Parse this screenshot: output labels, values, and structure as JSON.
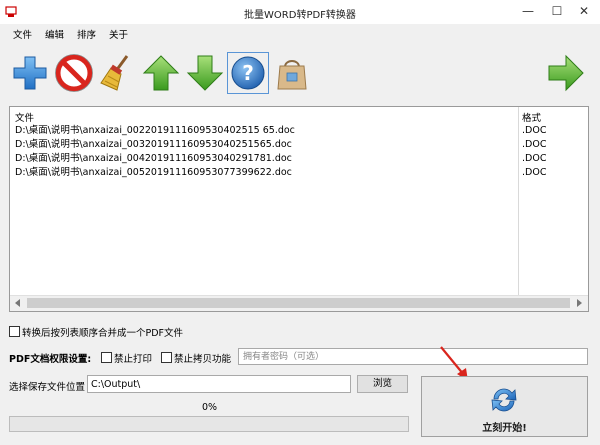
{
  "window": {
    "title": "批量WORD转PDF转换器",
    "minimize": "—",
    "maximize": "☐",
    "close": "✕"
  },
  "menu": [
    "文件",
    "编辑",
    "排序",
    "关于"
  ],
  "toolbar": {
    "buttons": [
      {
        "icon": "add-icon"
      },
      {
        "icon": "remove-icon"
      },
      {
        "icon": "broom-icon"
      },
      {
        "icon": "move-up-icon"
      },
      {
        "icon": "move-down-icon"
      },
      {
        "icon": "help-icon"
      },
      {
        "icon": "shopping-bag-icon"
      },
      {
        "icon": "next-arrow-icon"
      }
    ]
  },
  "file_table": {
    "columns": [
      "文件",
      "格式"
    ],
    "rows": [
      {
        "file": "D:\\桌面\\说明书\\anxaizai_0022019111609530402515 65.doc",
        "format": ".DOC"
      },
      {
        "file": "D:\\桌面\\说明书\\anxaizai_003201911160953040251565.doc",
        "format": ".DOC"
      },
      {
        "file": "D:\\桌面\\说明书\\anxaizai_004201911160953040291781.doc",
        "format": ".DOC"
      },
      {
        "file": "D:\\桌面\\说明书\\anxaizai_005201911160953077399622.doc",
        "format": ".DOC"
      }
    ]
  },
  "merge_option": {
    "label": "转换后按列表顺序合并成一个PDF文件",
    "checked": false
  },
  "permissions": {
    "label": "PDF文档权限设置:",
    "no_print": {
      "label": "禁止打印",
      "checked": false
    },
    "no_copy": {
      "label": "禁止拷贝功能",
      "checked": false
    },
    "password_placeholder": "拥有者密码（可选）",
    "password_value": ""
  },
  "output": {
    "label": "选择保存文件位置",
    "path": "C:\\Output\\",
    "browse_label": "浏览"
  },
  "progress": {
    "text": "0%",
    "value": 0
  },
  "start_button": {
    "label": "立刻开始!",
    "icon": "refresh-icon"
  },
  "colors": {
    "accent_blue": "#2a7fd0",
    "green": "#5cb83a",
    "red": "#d9251d",
    "annotation_arrow": "#d9251d"
  }
}
